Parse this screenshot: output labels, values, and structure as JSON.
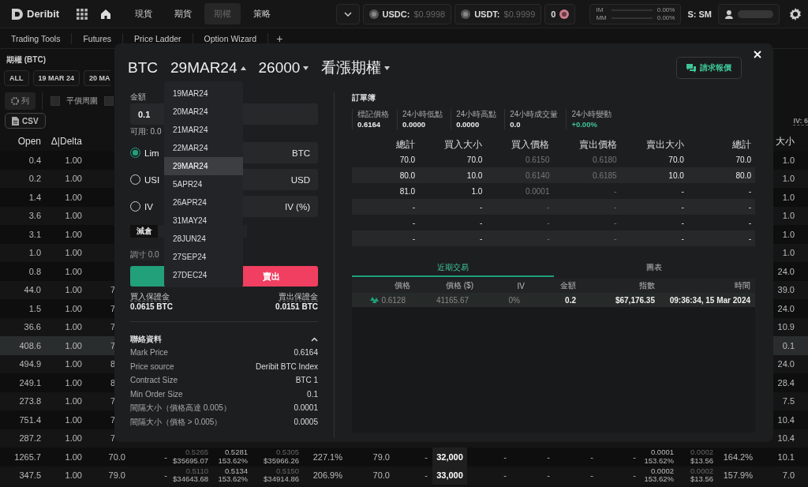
{
  "nav": {
    "brand": "Deribit",
    "links": [
      {
        "label": "現貨",
        "selected": false
      },
      {
        "label": "期貨",
        "selected": false
      },
      {
        "label": "期權",
        "selected": true
      },
      {
        "label": "策略",
        "selected": false
      }
    ],
    "tickers": [
      {
        "label": "USDC:",
        "value": "$0.9998"
      },
      {
        "label": "USDT:",
        "value": "$0.9999"
      }
    ],
    "notifications": "0",
    "margins": [
      {
        "label": "IM",
        "value": "0.00%",
        "level": 0
      },
      {
        "label": "MM",
        "value": "0.00%",
        "level": 0
      }
    ],
    "account_mode": "S: SM"
  },
  "workspace_tabs": [
    "Trading Tools",
    "Futures",
    "Price Ladder",
    "Option Wizard"
  ],
  "add_tab": "+",
  "chain": {
    "title": "期權 (BTC)",
    "expiry_filters": [
      {
        "label": "ALL",
        "selected": false
      },
      {
        "label": "19 MAR 24",
        "selected": false
      },
      {
        "label": "20 MA",
        "selected": false
      }
    ],
    "columns_button": "列",
    "toggles": [
      {
        "label": "平價周圍",
        "checked": false
      },
      {
        "checked": false
      }
    ],
    "export_button": "CSV",
    "iv_label": "IV: 6",
    "columns": [
      "Open",
      "Δ|Delta"
    ],
    "size_column": "大小",
    "rows": [
      {
        "open": "0.4",
        "delta": "1.00",
        "size": "1.0",
        "selected": false
      },
      {
        "open": "0.2",
        "delta": "1.00",
        "size": "1.0",
        "selected": false
      },
      {
        "open": "1.4",
        "delta": "1.00",
        "size": "1.0",
        "selected": false
      },
      {
        "open": "3.6",
        "delta": "1.00",
        "size": "1.0",
        "selected": false
      },
      {
        "open": "3.1",
        "delta": "1.00",
        "size": "1.0",
        "selected": false
      },
      {
        "open": "1.0",
        "delta": "1.00",
        "size": "1.0",
        "selected": false
      },
      {
        "open": "0.8",
        "delta": "1.00",
        "size": "24.0",
        "selected": false
      },
      {
        "open": "44.0",
        "delta": "1.00",
        "calls": [
          "7"
        ],
        "size": "39.0",
        "selected": false
      },
      {
        "open": "1.5",
        "delta": "1.00",
        "calls": [
          "7"
        ],
        "size": "24.0",
        "selected": false
      },
      {
        "open": "36.6",
        "delta": "1.00",
        "calls": [
          "7"
        ],
        "size": "10.9",
        "selected": false
      },
      {
        "open": "408.6",
        "delta": "1.00",
        "calls": [
          "7"
        ],
        "size": "0.1",
        "selected": true
      },
      {
        "open": "494.9",
        "delta": "1.00",
        "calls": [
          "8"
        ],
        "size": "24.0",
        "selected": false
      },
      {
        "open": "249.1",
        "delta": "1.00",
        "calls": [
          "8"
        ],
        "size": "28.4",
        "selected": false
      },
      {
        "open": "273.8",
        "delta": "1.00",
        "calls": [
          "7"
        ],
        "size": "7.5",
        "selected": false
      },
      {
        "open": "751.4",
        "delta": "1.00",
        "calls": [
          "7"
        ],
        "size": "10.4",
        "selected": false
      },
      {
        "open": "287.2",
        "delta": "1.00",
        "calls": [
          "7"
        ],
        "size": "10.4",
        "selected": false
      },
      {
        "open": "1265.7",
        "delta": "1.00",
        "calls": [
          "70.0",
          "-",
          [
            "0.5265",
            "$35695.07"
          ],
          [
            "0.5281",
            "153.62%"
          ],
          [
            "0.5305",
            "$35966.26"
          ],
          "227.1%",
          "79.0",
          "-"
        ],
        "strike": "32,000",
        "puts": [
          "-",
          "-",
          "-",
          "-",
          [
            "0.0001",
            "153.62%"
          ],
          [
            "0.0002",
            "$13.56"
          ],
          "164.2%"
        ],
        "size": "10.1",
        "selected": false
      },
      {
        "open": "347.5",
        "delta": "1.00",
        "calls": [
          "79.0",
          "-",
          [
            "0.5110",
            "$34643.68"
          ],
          [
            "0.5134",
            "153.62%"
          ],
          [
            "0.5150",
            "$34914.86"
          ],
          "206.9%",
          "70.0",
          "-"
        ],
        "strike": "33,000",
        "puts": [
          "-",
          "-",
          "-",
          "-",
          [
            "0.0002",
            "153.62%"
          ],
          [
            "0.0002",
            "$13.56"
          ],
          "157.9%"
        ],
        "size": "7.0",
        "selected": false
      }
    ]
  },
  "ticket": {
    "instrument": "BTC",
    "expiry": "29MAR24",
    "strike": "26000",
    "option_type": "看漲期權",
    "quote_button": "請求報價",
    "expiries": [
      {
        "label": "19MAR24",
        "selected": false
      },
      {
        "label": "20MAR24",
        "selected": false
      },
      {
        "label": "21MAR24",
        "selected": false
      },
      {
        "label": "22MAR24",
        "selected": false
      },
      {
        "label": "29MAR24",
        "selected": true
      },
      {
        "label": "5APR24",
        "selected": false
      },
      {
        "label": "26APR24",
        "selected": false
      },
      {
        "label": "31MAY24",
        "selected": false
      },
      {
        "label": "28JUN24",
        "selected": false
      },
      {
        "label": "27SEP24",
        "selected": false
      },
      {
        "label": "27DEC24",
        "selected": false
      }
    ],
    "amount": {
      "label": "金額",
      "value": "0.1",
      "available": "可用: 0.0"
    },
    "price_modes": [
      {
        "label": "Lim",
        "unit": "BTC",
        "selected": true
      },
      {
        "label": "USI",
        "unit": "USD",
        "selected": false
      },
      {
        "label": "IV",
        "unit": "IV (%)",
        "selected": false
      }
    ],
    "reduce_button": "減倉",
    "size_hint": "調寸 0.0",
    "sell_button": "賣出",
    "margins": [
      {
        "label": "買入保證金",
        "value": "0.0615 BTC"
      },
      {
        "label": "賣出保證金",
        "value": "0.0151 BTC"
      }
    ],
    "contract": {
      "title": "聯絡資料",
      "expanded": true,
      "rows": [
        [
          "Mark Price",
          "0.6164"
        ],
        [
          "Price source",
          "Deribit BTC Index"
        ],
        [
          "Contract Size",
          "BTC 1"
        ],
        [
          "Min Order Size",
          "0.1"
        ],
        [
          "間隔大小（價格高達 0.005）",
          "0.0001"
        ],
        [
          "間隔大小（價格 > 0.005）",
          "0.0005"
        ]
      ]
    },
    "order_book": {
      "title": "訂單簿",
      "stats": [
        {
          "label": "標記價格",
          "value": "0.6164",
          "kind": "plain"
        },
        {
          "label": "24小時低點",
          "value": "0.0000",
          "kind": "plain"
        },
        {
          "label": "24小時高點",
          "value": "0.0000",
          "kind": "plain"
        },
        {
          "label": "24小時成交量",
          "value": "0.0",
          "kind": "plain"
        },
        {
          "label": "24小時變動",
          "value": "+0.00%",
          "kind": "change"
        }
      ],
      "columns": [
        "總計",
        "買入大小",
        "買入價格",
        "賣出價格",
        "賣出大小",
        "總計"
      ],
      "rows": [
        [
          "70.0",
          "70.0",
          "0.6150",
          "0.6180",
          "70.0",
          "70.0"
        ],
        [
          "80.0",
          "10.0",
          "0.6140",
          "0.6185",
          "10.0",
          "80.0"
        ],
        [
          "81.0",
          "1.0",
          "0.0001",
          "-",
          "-",
          "-"
        ],
        [
          "-",
          "-",
          "-",
          "-",
          "-",
          "-"
        ],
        [
          "-",
          "-",
          "-",
          "-",
          "-",
          "-"
        ],
        [
          "-",
          "-",
          "-",
          "-",
          "-",
          "-"
        ]
      ]
    },
    "trade_tabs": [
      {
        "label": "近期交易",
        "selected": true
      },
      {
        "label": "圖表",
        "selected": false
      }
    ],
    "trades": {
      "columns": [
        "價格",
        "價格 ($)",
        "IV",
        "金額",
        "指數",
        "時間"
      ],
      "rows": [
        [
          "0.6128",
          "41165.67",
          "0%",
          "0.2",
          "$67,176.35",
          "09:36:34, 15 Mar 2024"
        ]
      ]
    }
  }
}
